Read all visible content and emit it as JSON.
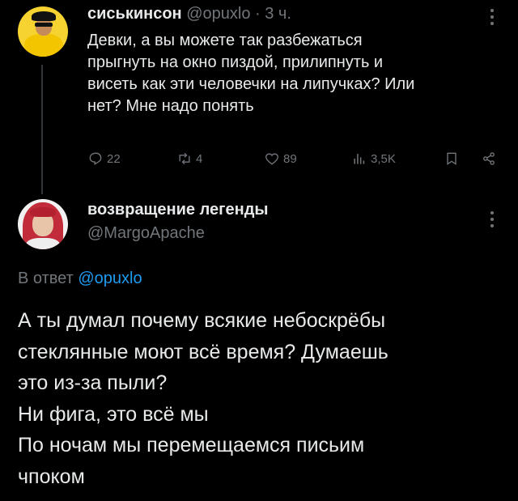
{
  "tweet": {
    "author_name": "сиськинсон",
    "author_handle": "@opuxlo",
    "separator": " · ",
    "time": "3 ч.",
    "text": "Девки, а вы можете так разбежаться\nпрыгнуть на окно пиздой, прилипнуть и\nвисеть как эти человечки на липучках? Или\nнет? Мне надо понять",
    "replies": "22",
    "retweets": "4",
    "likes": "89",
    "views": "3,5K"
  },
  "reply": {
    "author_name": "возвращение легенды",
    "author_handle": "@MargoApache",
    "reply_prefix": "В ответ ",
    "reply_to": "@opuxlo",
    "text": "А ты думал почему всякие небоскрёбы\nстеклянные моют всё время? Думаешь\nэто из-за пыли?\nНи фига, это всё мы\nПо ночам мы перемещаемся письим\nчпоком"
  },
  "colors": {
    "background": "#000000",
    "text": "#e7e9ea",
    "muted": "#71767b",
    "link": "#1d9bf0",
    "avatar1_bg": "#f7d332",
    "avatar2_hair": "#c12b3a"
  },
  "icons": [
    "more-icon",
    "reply-icon",
    "retweet-icon",
    "like-icon",
    "views-icon",
    "bookmark-icon",
    "share-icon"
  ]
}
